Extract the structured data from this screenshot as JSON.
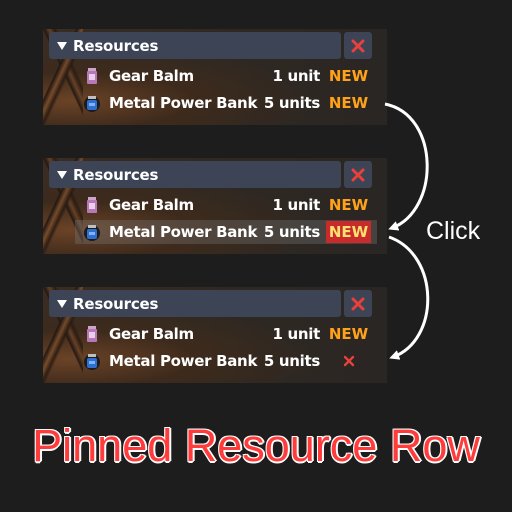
{
  "panels": [
    {
      "title": "Resources",
      "rows": [
        {
          "name": "Gear Balm",
          "qty": "1 unit",
          "badge": "NEW"
        },
        {
          "name": "Metal Power Bank",
          "qty": "5 units",
          "badge": "NEW"
        }
      ]
    },
    {
      "title": "Resources",
      "rows": [
        {
          "name": "Gear Balm",
          "qty": "1 unit",
          "badge": "NEW"
        },
        {
          "name": "Metal Power Bank",
          "qty": "5 units",
          "badge": "NEW"
        }
      ]
    },
    {
      "title": "Resources",
      "rows": [
        {
          "name": "Gear Balm",
          "qty": "1 unit",
          "badge": "NEW"
        },
        {
          "name": "Metal Power Bank",
          "qty": "5 units",
          "badge": ""
        }
      ]
    }
  ],
  "annotation": {
    "click_label": "Click"
  },
  "caption": "Pinned Resource Row",
  "colors": {
    "header_bg": "#3c4456",
    "close_x": "#e8403a",
    "badge_new": "#ffa21a",
    "badge_hot_bg": "#c92b2b",
    "caption": "#ff3b3b"
  },
  "icons": {
    "gear_balm": "pink-jar-icon",
    "metal_power_bank": "blue-battery-icon"
  }
}
